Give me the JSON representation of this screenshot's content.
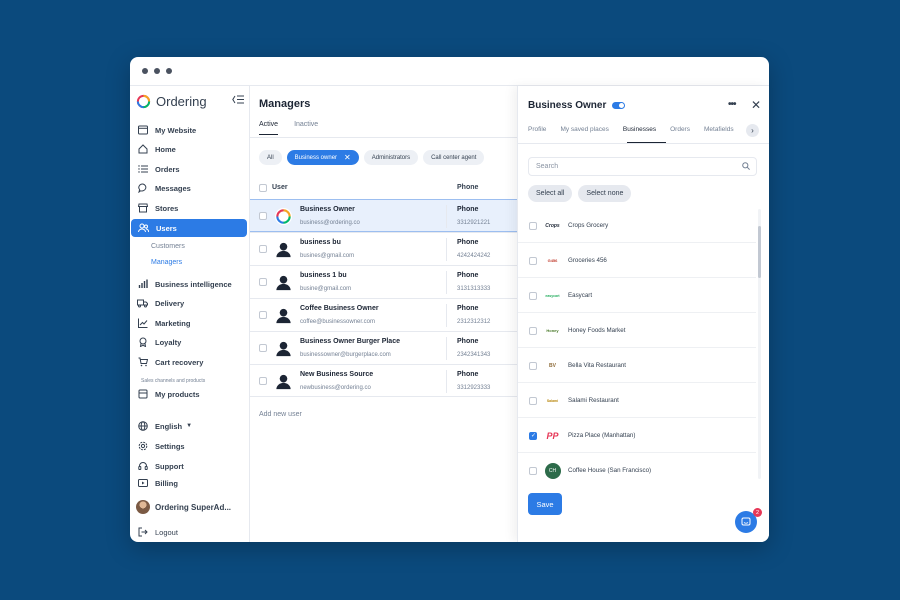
{
  "app": {
    "brand": "Ordering",
    "accent": "#2c7be5",
    "background": "#0b4a7d"
  },
  "sidebar": {
    "top_items": [
      {
        "label": "My Website",
        "icon": "browser-icon"
      },
      {
        "label": "Home",
        "icon": "home-icon"
      },
      {
        "label": "Orders",
        "icon": "list-icon"
      },
      {
        "label": "Messages",
        "icon": "chat-icon"
      },
      {
        "label": "Stores",
        "icon": "store-icon"
      },
      {
        "label": "Users",
        "icon": "users-icon",
        "active": true
      }
    ],
    "users_sub": [
      {
        "label": "Customers"
      },
      {
        "label": "Managers",
        "active": true
      }
    ],
    "mid_items": [
      {
        "label": "Business intelligence",
        "icon": "bar-chart-icon"
      },
      {
        "label": "Delivery",
        "icon": "truck-icon"
      },
      {
        "label": "Marketing",
        "icon": "trend-icon"
      },
      {
        "label": "Loyalty",
        "icon": "award-icon"
      },
      {
        "label": "Cart recovery",
        "icon": "cart-icon"
      }
    ],
    "section_label": "Sales channels and products",
    "products_item": {
      "label": "My products",
      "icon": "box-icon"
    },
    "bottom_items": [
      {
        "label": "English",
        "icon": "globe-icon"
      },
      {
        "label": "Settings",
        "icon": "gear-icon"
      },
      {
        "label": "Support",
        "icon": "headset-icon"
      },
      {
        "label": "Billing",
        "icon": "billing-icon"
      }
    ],
    "user_name": "Ordering SuperAd...",
    "logout": "Logout"
  },
  "main": {
    "title": "Managers",
    "tabs": [
      {
        "label": "Active",
        "active": true
      },
      {
        "label": "Inactive"
      }
    ],
    "filters": [
      {
        "label": "All"
      },
      {
        "label": "Business owner",
        "active": true
      },
      {
        "label": "Administrators"
      },
      {
        "label": "Call center agent"
      }
    ],
    "columns": {
      "user": "User",
      "phone": "Phone"
    },
    "rows": [
      {
        "name": "Business Owner",
        "email": "business@ordering.co",
        "phone_label": "Phone",
        "phone": "3312921221",
        "selected": true,
        "logo": true
      },
      {
        "name": "business bu",
        "email": "busines@gmail.com",
        "phone_label": "Phone",
        "phone": "4242424242"
      },
      {
        "name": "business 1 bu",
        "email": "busine@gmail.com",
        "phone_label": "Phone",
        "phone": "3131313333"
      },
      {
        "name": "Coffee Business Owner",
        "email": "coffee@businessowner.com",
        "phone_label": "Phone",
        "phone": "2312312312"
      },
      {
        "name": "Business Owner Burger Place",
        "email": "businessowner@burgerplace.com",
        "phone_label": "Phone",
        "phone": "2342341343"
      },
      {
        "name": "New Business Source",
        "email": "newbusiness@ordering.co",
        "phone_label": "Phone",
        "phone": "3312923333"
      }
    ],
    "add_user": "Add new user"
  },
  "drawer": {
    "title": "Business Owner",
    "tabs": [
      {
        "label": "Profile"
      },
      {
        "label": "My saved places"
      },
      {
        "label": "Businesses",
        "active": true
      },
      {
        "label": "Orders"
      },
      {
        "label": "Metafields"
      }
    ],
    "search_placeholder": "Search",
    "select_all": "Select all",
    "select_none": "Select none",
    "businesses": [
      {
        "name": "Crops Grocery",
        "checked": false,
        "logo_text": "Crops"
      },
      {
        "name": "Groceries 456",
        "checked": false,
        "logo_text": "G456"
      },
      {
        "name": "Easycart",
        "checked": false,
        "logo_text": "easycart"
      },
      {
        "name": "Honey Foods Market",
        "checked": false,
        "logo_text": "Honey"
      },
      {
        "name": "Bella Vita Restaurant",
        "checked": false,
        "logo_text": "BV"
      },
      {
        "name": "Salami Restaurant",
        "checked": false,
        "logo_text": "Salami"
      },
      {
        "name": "Pizza Place (Manhattan)",
        "checked": true,
        "logo_text": "PP"
      },
      {
        "name": "Coffee House (San Francisco)",
        "checked": false,
        "logo_text": "CH"
      }
    ],
    "save": "Save",
    "chat_badge": "2"
  }
}
